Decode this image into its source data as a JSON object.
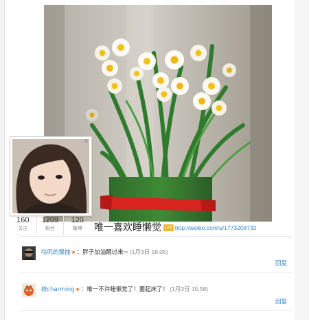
{
  "profile": {
    "name": "唯一喜欢睡懒觉",
    "level_badge": "Lv.6",
    "url": "http://weibo.com/u/1773208732",
    "stats": [
      {
        "count": "160",
        "label": "关注"
      },
      {
        "count": "1209",
        "label": "粉丝"
      },
      {
        "count": "120",
        "label": "微博"
      }
    ]
  },
  "comments": [
    {
      "user": "咕叽的猴拽",
      "vip_icon": "star-badge-icon",
      "separator": "：",
      "text": "胖子加油醒过来~",
      "time": "(1月3日 16:05)",
      "reply_label": "回复"
    },
    {
      "user": "统charming",
      "vip_icon": "star-badge-icon",
      "separator": "：",
      "text": "唯一不许睡懒觉了！要起床了！",
      "time": "(1月3日 15:58)",
      "reply_label": "回复"
    }
  ],
  "colors": {
    "link": "#3a86c6",
    "badge": "#f0b72a",
    "ribbon": "#d9231f"
  }
}
